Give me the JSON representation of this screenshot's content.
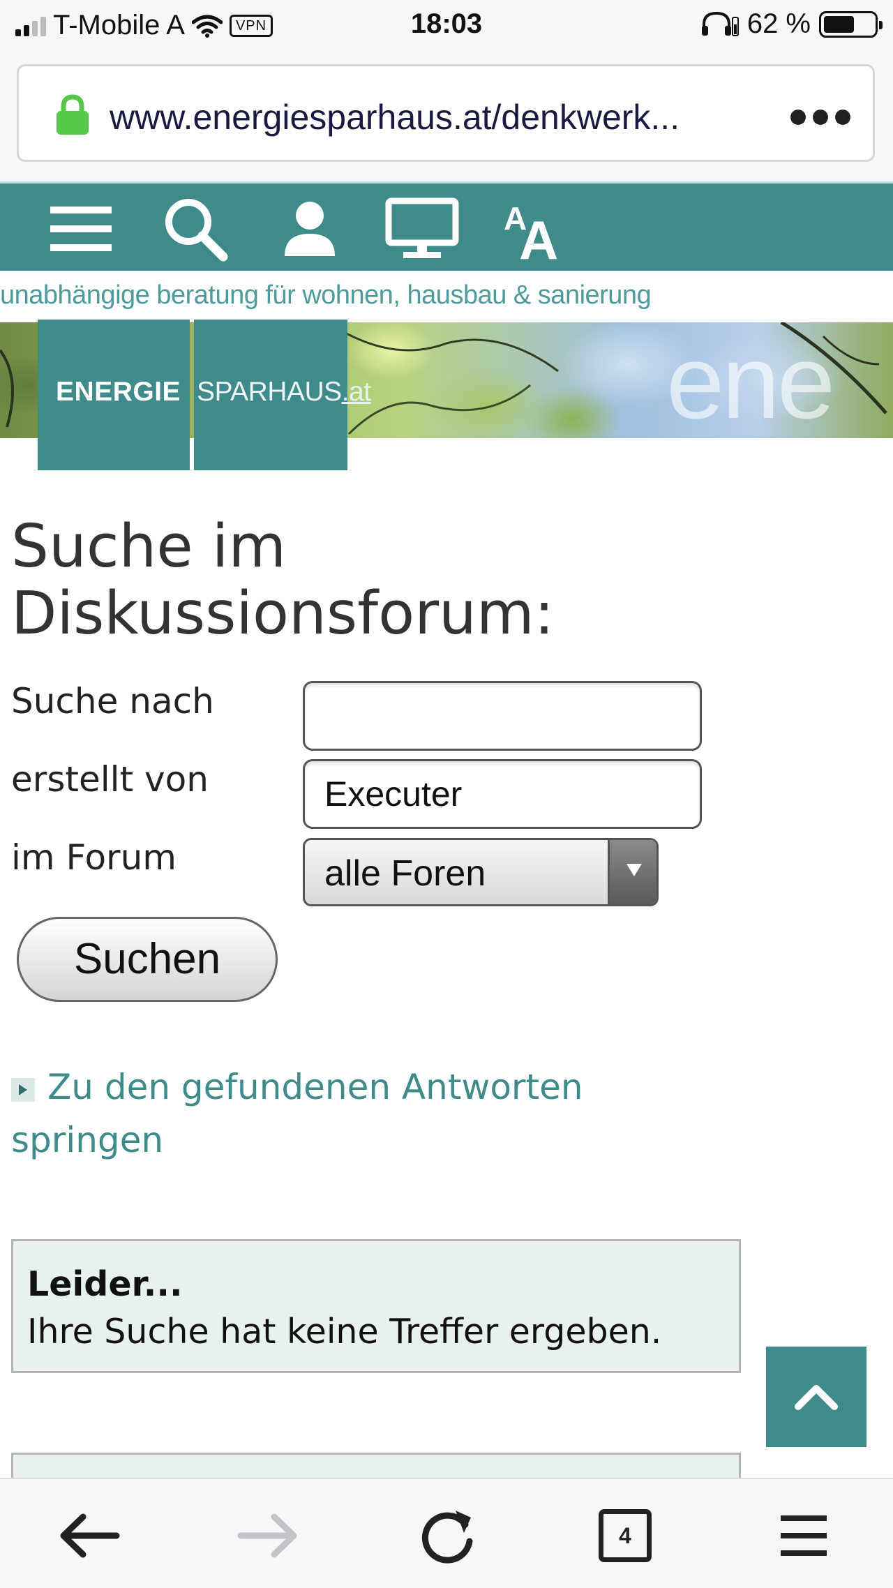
{
  "status_bar": {
    "carrier": "T-Mobile A",
    "vpn": "VPN",
    "time": "18:03",
    "battery": "62 %",
    "battery_level": 0.62
  },
  "browser": {
    "url": "www.energiesparhaus.at/denkwerk..."
  },
  "site": {
    "tagline": "unabhängige beratung für wohnen, hausbau & sanierung",
    "banner_word": "ene",
    "logo_left": "ENERGIE",
    "logo_right": "SPARHAUS",
    "logo_suffix": ".at",
    "nav_icons": [
      "menu-icon",
      "search-icon",
      "user-icon",
      "monitor-icon",
      "font-size-icon"
    ],
    "accent_color": "#3f8a8a"
  },
  "search": {
    "title": "Suche im Diskussionsforum:",
    "label_query": "Suche nach",
    "query_value": "",
    "label_author": "erstellt von",
    "author_value": "Executer",
    "label_forum": "im Forum",
    "forum_selected": "alle Foren",
    "submit_label": "Suchen"
  },
  "results": {
    "jump_link": "Zu den gefundenen Antworten springen",
    "notice_title": "Leider...",
    "notice_body": "Ihre Suche hat keine Treffer ergeben."
  },
  "toolbar": {
    "tab_count": "4"
  }
}
